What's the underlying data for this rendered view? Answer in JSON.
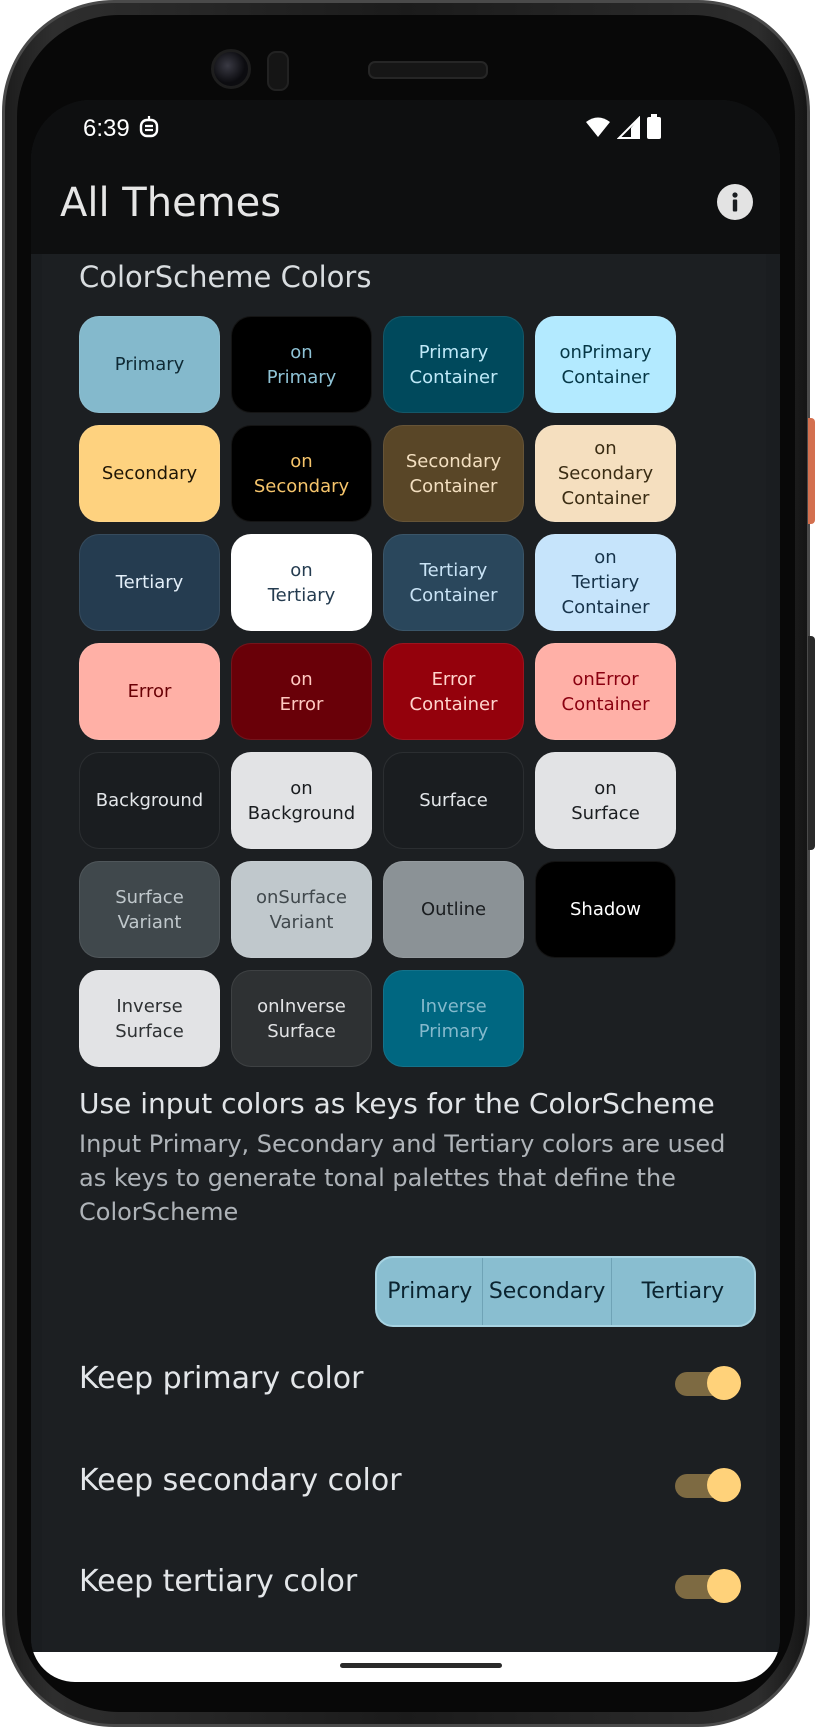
{
  "status_bar": {
    "time": "6:39"
  },
  "app_bar": {
    "title": "All Themes"
  },
  "colorscheme": {
    "title": "ColorScheme Colors",
    "swatches": [
      {
        "line1": "Primary",
        "line2": "",
        "line3": "",
        "bg": "#84b9cc",
        "fg": "#0f2a35"
      },
      {
        "line1": "on",
        "line2": "Primary",
        "line3": "",
        "bg": "#000000",
        "fg": "#8fc3d6"
      },
      {
        "line1": "Primary",
        "line2": "Container",
        "line3": "",
        "bg": "#00495c",
        "fg": "#bfe9f8"
      },
      {
        "line1": "onPrimary",
        "line2": "Container",
        "line3": "",
        "bg": "#b3eaff",
        "fg": "#063746"
      },
      {
        "line1": "Secondary",
        "line2": "",
        "line3": "",
        "bg": "#fed27f",
        "fg": "#1f1606"
      },
      {
        "line1": "on",
        "line2": "Secondary",
        "line3": "",
        "bg": "#000000",
        "fg": "#f5c46b"
      },
      {
        "line1": "Secondary",
        "line2": "Container",
        "line3": "",
        "bg": "#594627",
        "fg": "#f3dfc0"
      },
      {
        "line1": "on",
        "line2": "Secondary",
        "line3": "Container",
        "bg": "#f5dfbf",
        "fg": "#3a2c13"
      },
      {
        "line1": "Tertiary",
        "line2": "",
        "line3": "",
        "bg": "#253c50",
        "fg": "#e2eef8"
      },
      {
        "line1": "on",
        "line2": "Tertiary",
        "line3": "",
        "bg": "#ffffff",
        "fg": "#253c50"
      },
      {
        "line1": "Tertiary",
        "line2": "Container",
        "line3": "",
        "bg": "#2a475c",
        "fg": "#c9e3f5"
      },
      {
        "line1": "on",
        "line2": "Tertiary",
        "line3": "Container",
        "bg": "#c6e4fb",
        "fg": "#17334a"
      },
      {
        "line1": "Error",
        "line2": "",
        "line3": "",
        "bg": "#ffb0a6",
        "fg": "#690005"
      },
      {
        "line1": "on",
        "line2": "Error",
        "line3": "",
        "bg": "#690008",
        "fg": "#ffc9c1"
      },
      {
        "line1": "Error",
        "line2": "Container",
        "line3": "",
        "bg": "#94010c",
        "fg": "#ffd4cc"
      },
      {
        "line1": "onError",
        "line2": "Container",
        "line3": "",
        "bg": "#ffb0a7",
        "fg": "#8a0010"
      },
      {
        "line1": "Background",
        "line2": "",
        "line3": "",
        "bg": "#1a1d20",
        "fg": "#e3e6e9"
      },
      {
        "line1": "on",
        "line2": "Background",
        "line3": "",
        "bg": "#e2e3e5",
        "fg": "#1a1d20"
      },
      {
        "line1": "Surface",
        "line2": "",
        "line3": "",
        "bg": "#1a1d20",
        "fg": "#e3e6e9"
      },
      {
        "line1": "on",
        "line2": "Surface",
        "line3": "",
        "bg": "#e2e3e5",
        "fg": "#1a1d20"
      },
      {
        "line1": "Surface",
        "line2": "Variant",
        "line3": "",
        "bg": "#40484c",
        "fg": "#c0c8cc"
      },
      {
        "line1": "onSurface",
        "line2": "Variant",
        "line3": "",
        "bg": "#c0c8cc",
        "fg": "#40484c"
      },
      {
        "line1": "Outline",
        "line2": "",
        "line3": "",
        "bg": "#8b9296",
        "fg": "#1a1d20"
      },
      {
        "line1": "Shadow",
        "line2": "",
        "line3": "",
        "bg": "#000000",
        "fg": "#ffffff"
      },
      {
        "line1": "Inverse",
        "line2": "Surface",
        "line3": "",
        "bg": "#e2e3e5",
        "fg": "#2e3133"
      },
      {
        "line1": "onInverse",
        "line2": "Surface",
        "line3": "",
        "bg": "#2e3133",
        "fg": "#e2e3e5"
      },
      {
        "line1": "Inverse",
        "line2": "Primary",
        "line3": "",
        "bg": "#006781",
        "fg": "#84b9cc"
      }
    ]
  },
  "input_keys": {
    "title": "Use input colors as keys for the ColorScheme",
    "description": "Input Primary, Secondary and Tertiary colors are used as keys to generate tonal palettes that define the ColorScheme",
    "segments": [
      "Primary",
      "Secondary",
      "Tertiary"
    ]
  },
  "toggles": [
    {
      "label": "Keep primary color",
      "on": true
    },
    {
      "label": "Keep secondary color",
      "on": true
    },
    {
      "label": "Keep tertiary color",
      "on": true
    }
  ],
  "colors": {
    "background": "#1a1d20",
    "appbar": "#0e0f10",
    "switch_thumb": "#ffd27a",
    "switch_track": "#7d6a42",
    "segment_bg": "#89bed0"
  }
}
